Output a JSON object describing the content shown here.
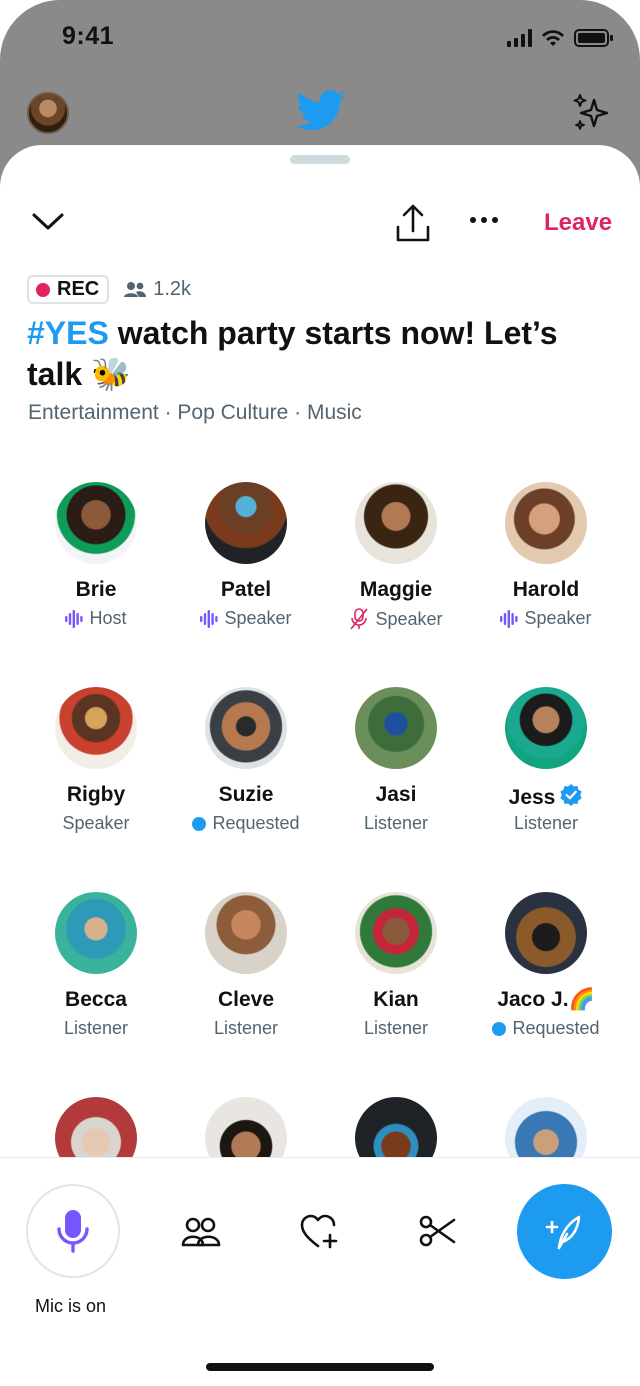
{
  "status_bar": {
    "time": "9:41"
  },
  "header": {
    "logo": "twitter-bird-icon"
  },
  "space": {
    "leave_label": "Leave",
    "rec_label": "REC",
    "listener_count": "1.2k",
    "title_hashtag": "#YES",
    "title_rest": " watch party starts now! Let’s talk 🐝",
    "topics": "Entertainment · Pop Culture · Music"
  },
  "participants": [
    {
      "name": "Brie",
      "role": "Host",
      "icon": "speaking-wave-icon"
    },
    {
      "name": "Patel",
      "role": "Speaker",
      "icon": "speaking-wave-icon"
    },
    {
      "name": "Maggie",
      "role": "Speaker",
      "icon": "mic-muted-icon"
    },
    {
      "name": "Harold",
      "role": "Speaker",
      "icon": "speaking-wave-icon"
    },
    {
      "name": "Rigby",
      "role": "Speaker",
      "icon": ""
    },
    {
      "name": "Suzie",
      "role": "Requested",
      "icon": "requested-dot"
    },
    {
      "name": "Jasi",
      "role": "Listener",
      "icon": ""
    },
    {
      "name": "Jess",
      "role": "Listener",
      "icon": "",
      "verified": true
    },
    {
      "name": "Becca",
      "role": "Listener",
      "icon": ""
    },
    {
      "name": "Cleve",
      "role": "Listener",
      "icon": ""
    },
    {
      "name": "Kian",
      "role": "Listener",
      "icon": ""
    },
    {
      "name": "Jaco J.🌈",
      "role": "Requested",
      "icon": "requested-dot"
    },
    {
      "name": "",
      "role": "",
      "icon": ""
    },
    {
      "name": "",
      "role": "",
      "icon": ""
    },
    {
      "name": "",
      "role": "",
      "icon": ""
    },
    {
      "name": "",
      "role": "",
      "icon": ""
    }
  ],
  "bottom_bar": {
    "mic_label": "Mic is on"
  },
  "colors": {
    "accent": "#1d9bf0",
    "leave": "#e0245e",
    "speaking": "#7856ff",
    "muted": "#e0245e"
  }
}
